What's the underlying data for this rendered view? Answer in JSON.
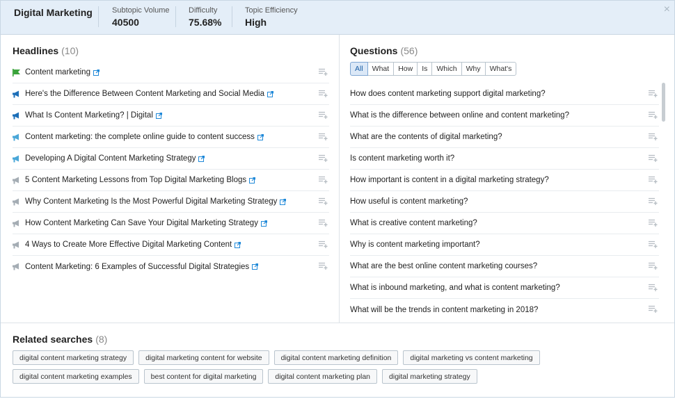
{
  "header": {
    "topic": "Digital Marketing",
    "metrics": [
      {
        "label": "Subtopic Volume",
        "value": "40500"
      },
      {
        "label": "Difficulty",
        "value": "75.68%"
      },
      {
        "label": "Topic Efficiency",
        "value": "High"
      }
    ],
    "close_icon": "×"
  },
  "headlines": {
    "title": "Headlines",
    "count": "(10)",
    "items": [
      {
        "text": "Content marketing",
        "icon": "green-flag-icon"
      },
      {
        "text": "Here's the Difference Between Content Marketing and Social Media",
        "icon": "blue-megaphone-icon"
      },
      {
        "text": "What Is Content Marketing? | Digital",
        "icon": "blue-megaphone-icon"
      },
      {
        "text": "Content marketing: the complete online guide to content success",
        "icon": "lightblue-megaphone-icon"
      },
      {
        "text": "Developing A Digital Content Marketing Strategy",
        "icon": "lightblue-megaphone-icon"
      },
      {
        "text": "5 Content Marketing Lessons from Top Digital Marketing Blogs",
        "icon": "gray-megaphone-icon"
      },
      {
        "text": "Why Content Marketing Is the Most Powerful Digital Marketing Strategy",
        "icon": "gray-megaphone-icon"
      },
      {
        "text": "How Content Marketing Can Save Your Digital Marketing Strategy",
        "icon": "gray-megaphone-icon"
      },
      {
        "text": "4 Ways to Create More Effective Digital Marketing Content",
        "icon": "gray-megaphone-icon"
      },
      {
        "text": "Content Marketing: 6 Examples of Successful Digital Strategies",
        "icon": "gray-megaphone-icon"
      }
    ]
  },
  "questions": {
    "title": "Questions",
    "count": "(56)",
    "filters": [
      "All",
      "What",
      "How",
      "Is",
      "Which",
      "Why",
      "What's"
    ],
    "active_filter": "All",
    "items": [
      "How does content marketing support digital marketing?",
      "What is the difference between online and content marketing?",
      "What are the contents of digital marketing?",
      "Is content marketing worth it?",
      "How important is content in a digital marketing strategy?",
      "How useful is content marketing?",
      "What is creative content marketing?",
      "Why is content marketing important?",
      "What are the best online content marketing courses?",
      "What is inbound marketing, and what is content marketing?",
      "What will be the trends in content marketing in 2018?"
    ]
  },
  "related": {
    "title": "Related searches",
    "count": "(8)",
    "tags": [
      "digital content marketing strategy",
      "digital marketing content for website",
      "digital content marketing definition",
      "digital marketing vs content marketing",
      "digital content marketing examples",
      "best content for digital marketing",
      "digital content marketing plan",
      "digital marketing strategy"
    ]
  },
  "colors": {
    "header_bg": "#e4eef8",
    "link_blue": "#1e88d8",
    "flag_green": "#3aa33a",
    "megaphone_blue": "#1d6fb8",
    "megaphone_lightblue": "#4aa7d8",
    "megaphone_gray": "#a5adb4"
  }
}
